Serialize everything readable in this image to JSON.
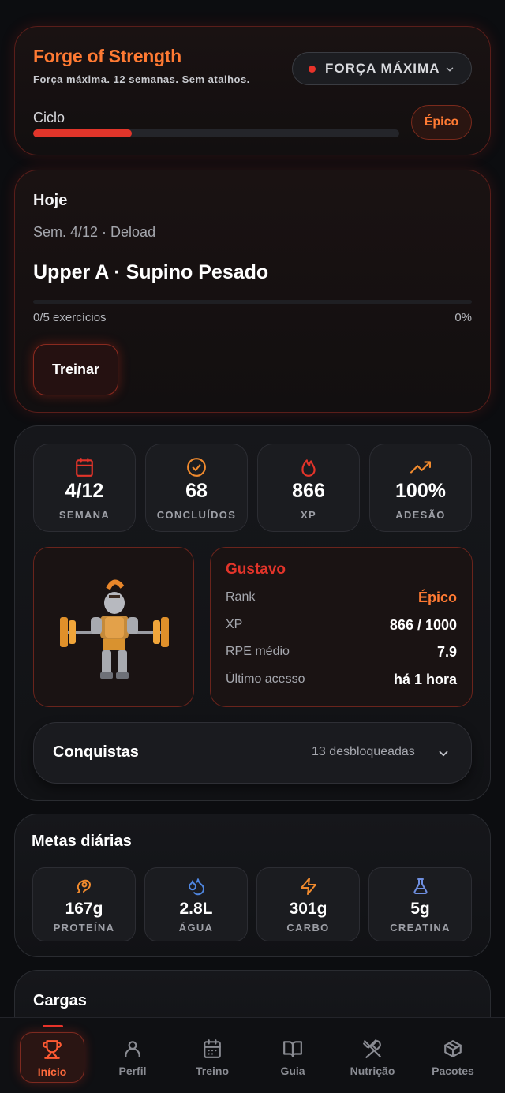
{
  "header": {
    "title": "Forge of Strength",
    "subtitle": "Força máxima. 12 semanas. Sem atalhos.",
    "mode_label": "FORÇA MÁXIMA",
    "cycle_label": "Ciclo",
    "cycle_progress": 0.27,
    "rank_badge": "Épico"
  },
  "today": {
    "heading": "Hoje",
    "week_text": "Sem. 4/12 · Deload",
    "workout_name": "Upper A · Supino Pesado",
    "exercises_text": "0/5 exercícios",
    "percent_text": "0%",
    "progress": 0,
    "train_button": "Treinar"
  },
  "stats": [
    {
      "icon": "calendar-icon",
      "value": "4/12",
      "label": "SEMANA"
    },
    {
      "icon": "check-circle-icon",
      "value": "68",
      "label": "CONCLUÍDOS"
    },
    {
      "icon": "flame-icon",
      "value": "866",
      "label": "XP"
    },
    {
      "icon": "trending-up-icon",
      "value": "100%",
      "label": "ADESÃO"
    }
  ],
  "profile": {
    "name": "Gustavo",
    "rows": [
      {
        "key": "Rank",
        "value": "Épico"
      },
      {
        "key": "XP",
        "value": "866 / 1000"
      },
      {
        "key": "RPE médio",
        "value": "7.9"
      },
      {
        "key": "Último acesso",
        "value": "há 1 hora"
      }
    ]
  },
  "achievements": {
    "title": "Conquistas",
    "count_text": "13 desbloqueadas"
  },
  "goals": {
    "heading": "Metas diárias",
    "items": [
      {
        "icon": "meat-icon",
        "value": "167g",
        "label": "PROTEÍNA"
      },
      {
        "icon": "droplets-icon",
        "value": "2.8L",
        "label": "ÁGUA"
      },
      {
        "icon": "zap-icon",
        "value": "301g",
        "label": "CARBO"
      },
      {
        "icon": "flask-icon",
        "value": "5g",
        "label": "CREATINA"
      }
    ]
  },
  "loads": {
    "heading": "Cargas"
  },
  "nav": {
    "items": [
      {
        "icon": "trophy-icon",
        "label": "Início",
        "active": true
      },
      {
        "icon": "user-icon",
        "label": "Perfil"
      },
      {
        "icon": "calendar-icon",
        "label": "Treino"
      },
      {
        "icon": "book-icon",
        "label": "Guia"
      },
      {
        "icon": "utensils-icon",
        "label": "Nutrição"
      },
      {
        "icon": "package-icon",
        "label": "Pacotes"
      }
    ]
  },
  "colors": {
    "accent_orange": "#ff7a33",
    "accent_red": "#e1352a",
    "background": "#0c0d10"
  }
}
